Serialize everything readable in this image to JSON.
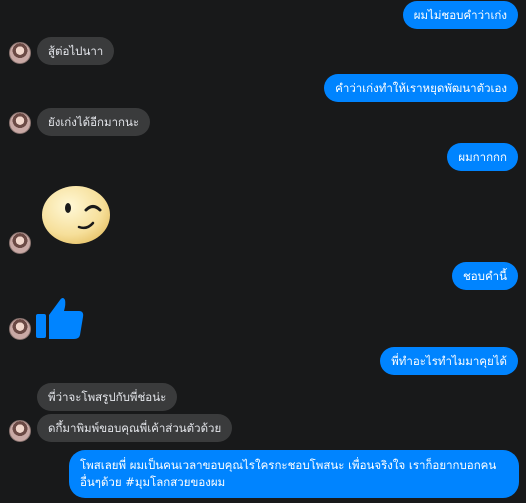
{
  "messages": {
    "m1": "ผมไม่ชอบคำว่าเก่ง",
    "m2": "สู้ต่อไปนาา",
    "m3": "คำว่าเก่งทำให้เราหยุดพัฒนาตัวเอง",
    "m4": "ยังเก่งได้อีกมากนะ",
    "m5": "ผมกากกก",
    "m6": "ชอบคำนี้",
    "m7": "พี่ทำอะไรทำไมมาคุยได้",
    "m8": "พี่ว่าจะโพสรูปกับพี่ช่อน่ะ",
    "m9": "ดกึ้มาพิมพ์ขอบคุณพี่เค้าส่วนตัวด้วย",
    "m10": "โพสเลยพี่ ผมเป็นคนเวลาขอบคุณไรใครกะชอบโพสนะ เพื่อนจริงใจ เราก็อยากบอกคนอื่นๆด้วย #มุมโลกสวยของผม"
  },
  "colors": {
    "background": "#18191a",
    "outgoing_bubble": "#0084ff",
    "incoming_bubble": "#3a3b3c",
    "thumb": "#0084ff"
  },
  "icons": {
    "sticker": "winking-face-sticker",
    "like": "thumbs-up-icon"
  }
}
